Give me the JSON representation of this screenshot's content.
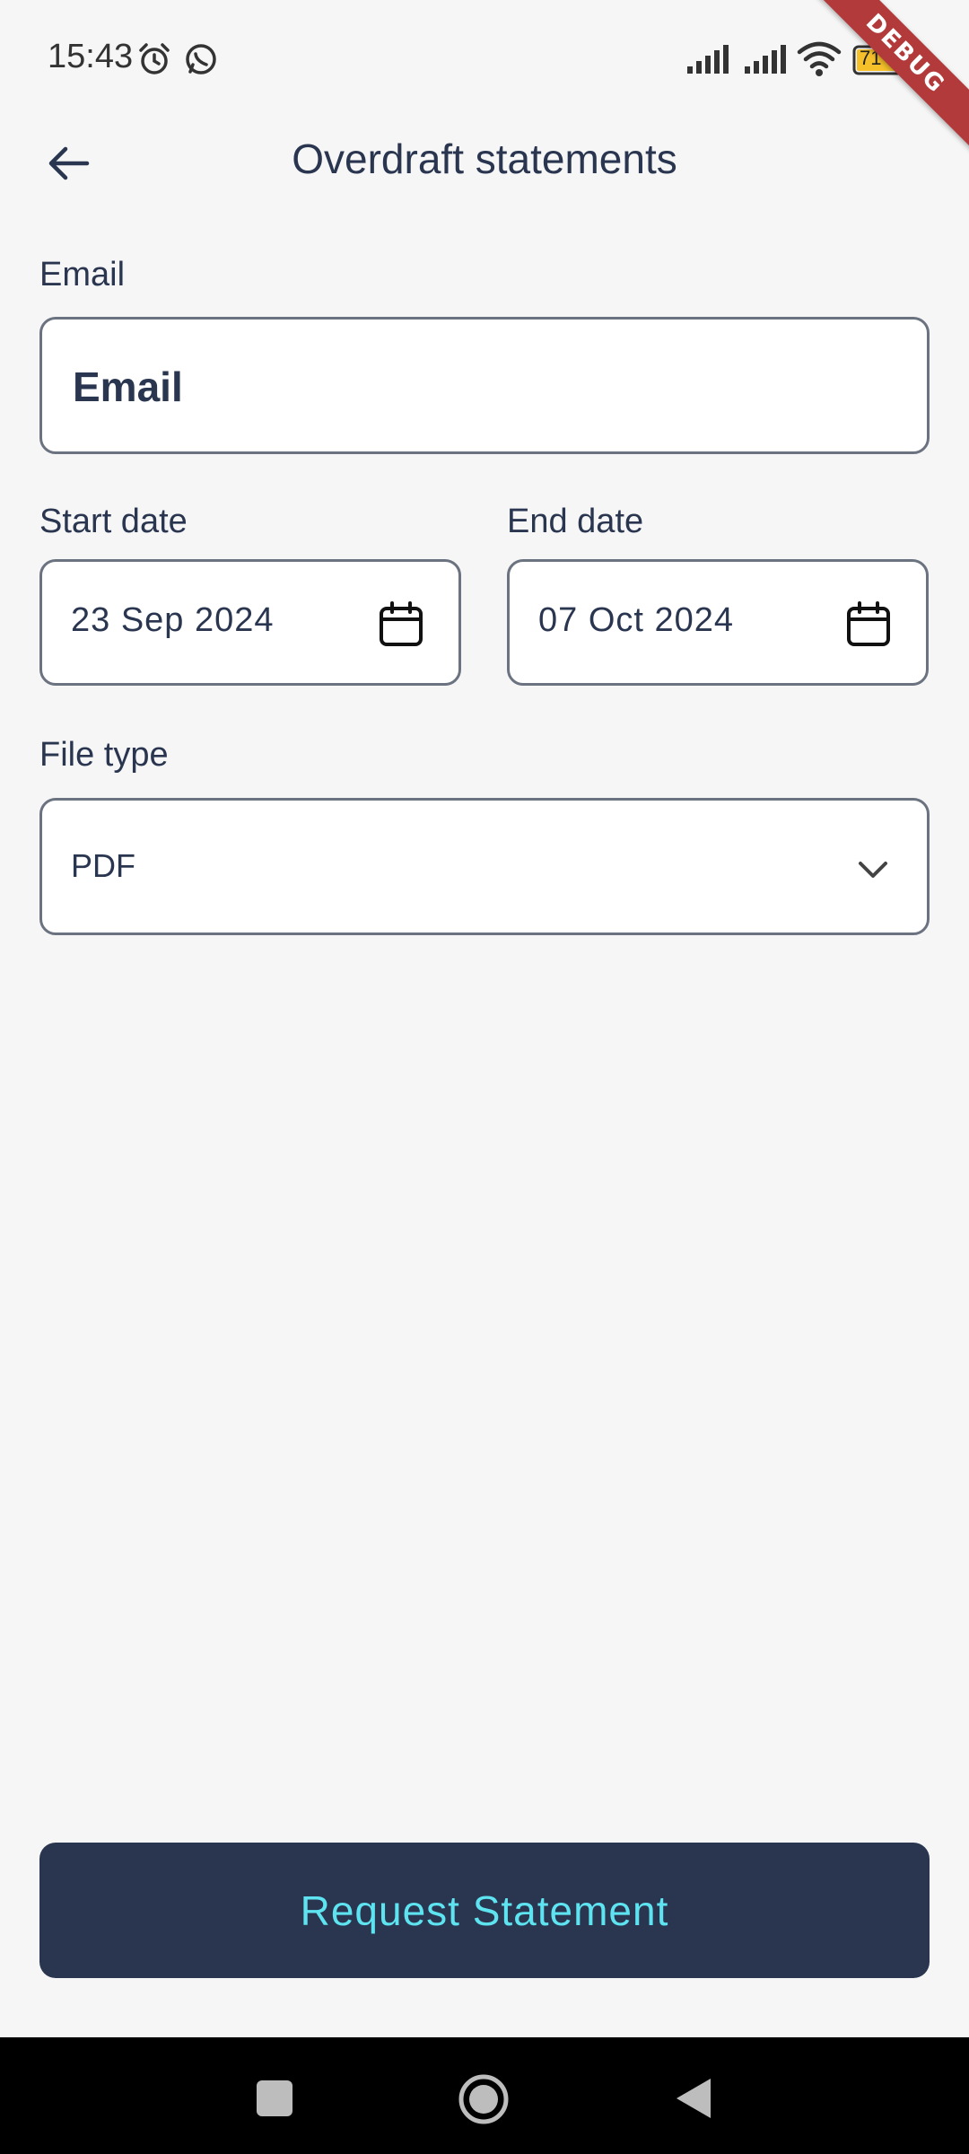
{
  "status_bar": {
    "time": "15:43",
    "battery_level": "71",
    "debug_label": "DEBUG",
    "icons": [
      "alarm-icon",
      "whatsapp-icon",
      "signal-icon",
      "signal-icon",
      "wifi-icon",
      "battery-icon"
    ]
  },
  "header": {
    "title": "Overdraft statements",
    "back_icon": "arrow-left-icon"
  },
  "form": {
    "email": {
      "label": "Email",
      "placeholder": "Email",
      "value": ""
    },
    "start_date": {
      "label": "Start date",
      "value": "23 Sep 2024",
      "icon": "calendar-icon"
    },
    "end_date": {
      "label": "End date",
      "value": "07 Oct 2024",
      "icon": "calendar-icon"
    },
    "file_type": {
      "label": "File type",
      "value": "PDF",
      "icon": "chevron-down-icon"
    }
  },
  "actions": {
    "request_label": "Request Statement"
  },
  "colors": {
    "background": "#f6f6f6",
    "primary": "#2a3650",
    "button_text": "#5ee3f0",
    "border": "#6b7280",
    "debug_ribbon": "#b33a3a"
  },
  "nav_bar": {
    "icons": [
      "recents-icon",
      "home-icon",
      "back-icon"
    ]
  }
}
